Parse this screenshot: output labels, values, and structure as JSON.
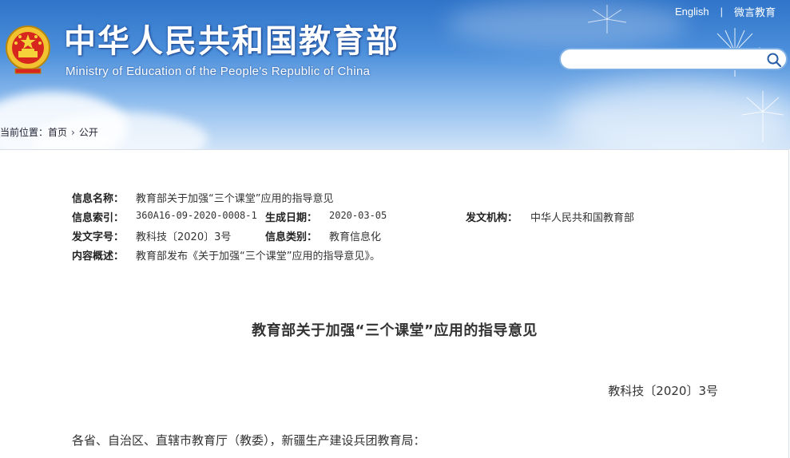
{
  "header": {
    "title": "中华人民共和国教育部",
    "subtitle": "Ministry of Education of the People's Republic of China",
    "links": {
      "english": "English",
      "separator": "|",
      "weibo": "微言教育"
    },
    "search": {
      "placeholder": "",
      "icon": "search-icon"
    },
    "emblem_icon": "national-emblem-icon"
  },
  "breadcrumb": {
    "prefix": "当前位置：",
    "home": "首页",
    "arrow": "›",
    "current": "公开"
  },
  "info": {
    "name_label": "信息名称：",
    "name_value": "教育部关于加强“三个课堂”应用的指导意见",
    "index_label": "信息索引：",
    "index_value": "360A16-09-2020-0008-1",
    "date_label": "生成日期：",
    "date_value": "2020-03-05",
    "org_label": "发文机构：",
    "org_value": "中华人民共和国教育部",
    "docno_label": "发文字号：",
    "docno_value": "教科技〔2020〕3号",
    "category_label": "信息类别：",
    "category_value": "教育信息化",
    "summary_label": "内容概述：",
    "summary_value": "教育部发布《关于加强“三个课堂”应用的指导意见》。"
  },
  "document": {
    "title": "教育部关于加强“三个课堂”应用的指导意见",
    "number": "教科技〔2020〕3号",
    "addressee": "各省、自治区、直辖市教育厅（教委），新疆生产建设兵团教育局："
  },
  "colors": {
    "banner_top": "#2f74c9",
    "banner_bottom": "#cfe3f8",
    "text": "#333333",
    "search_border": "#7fb0e6"
  }
}
